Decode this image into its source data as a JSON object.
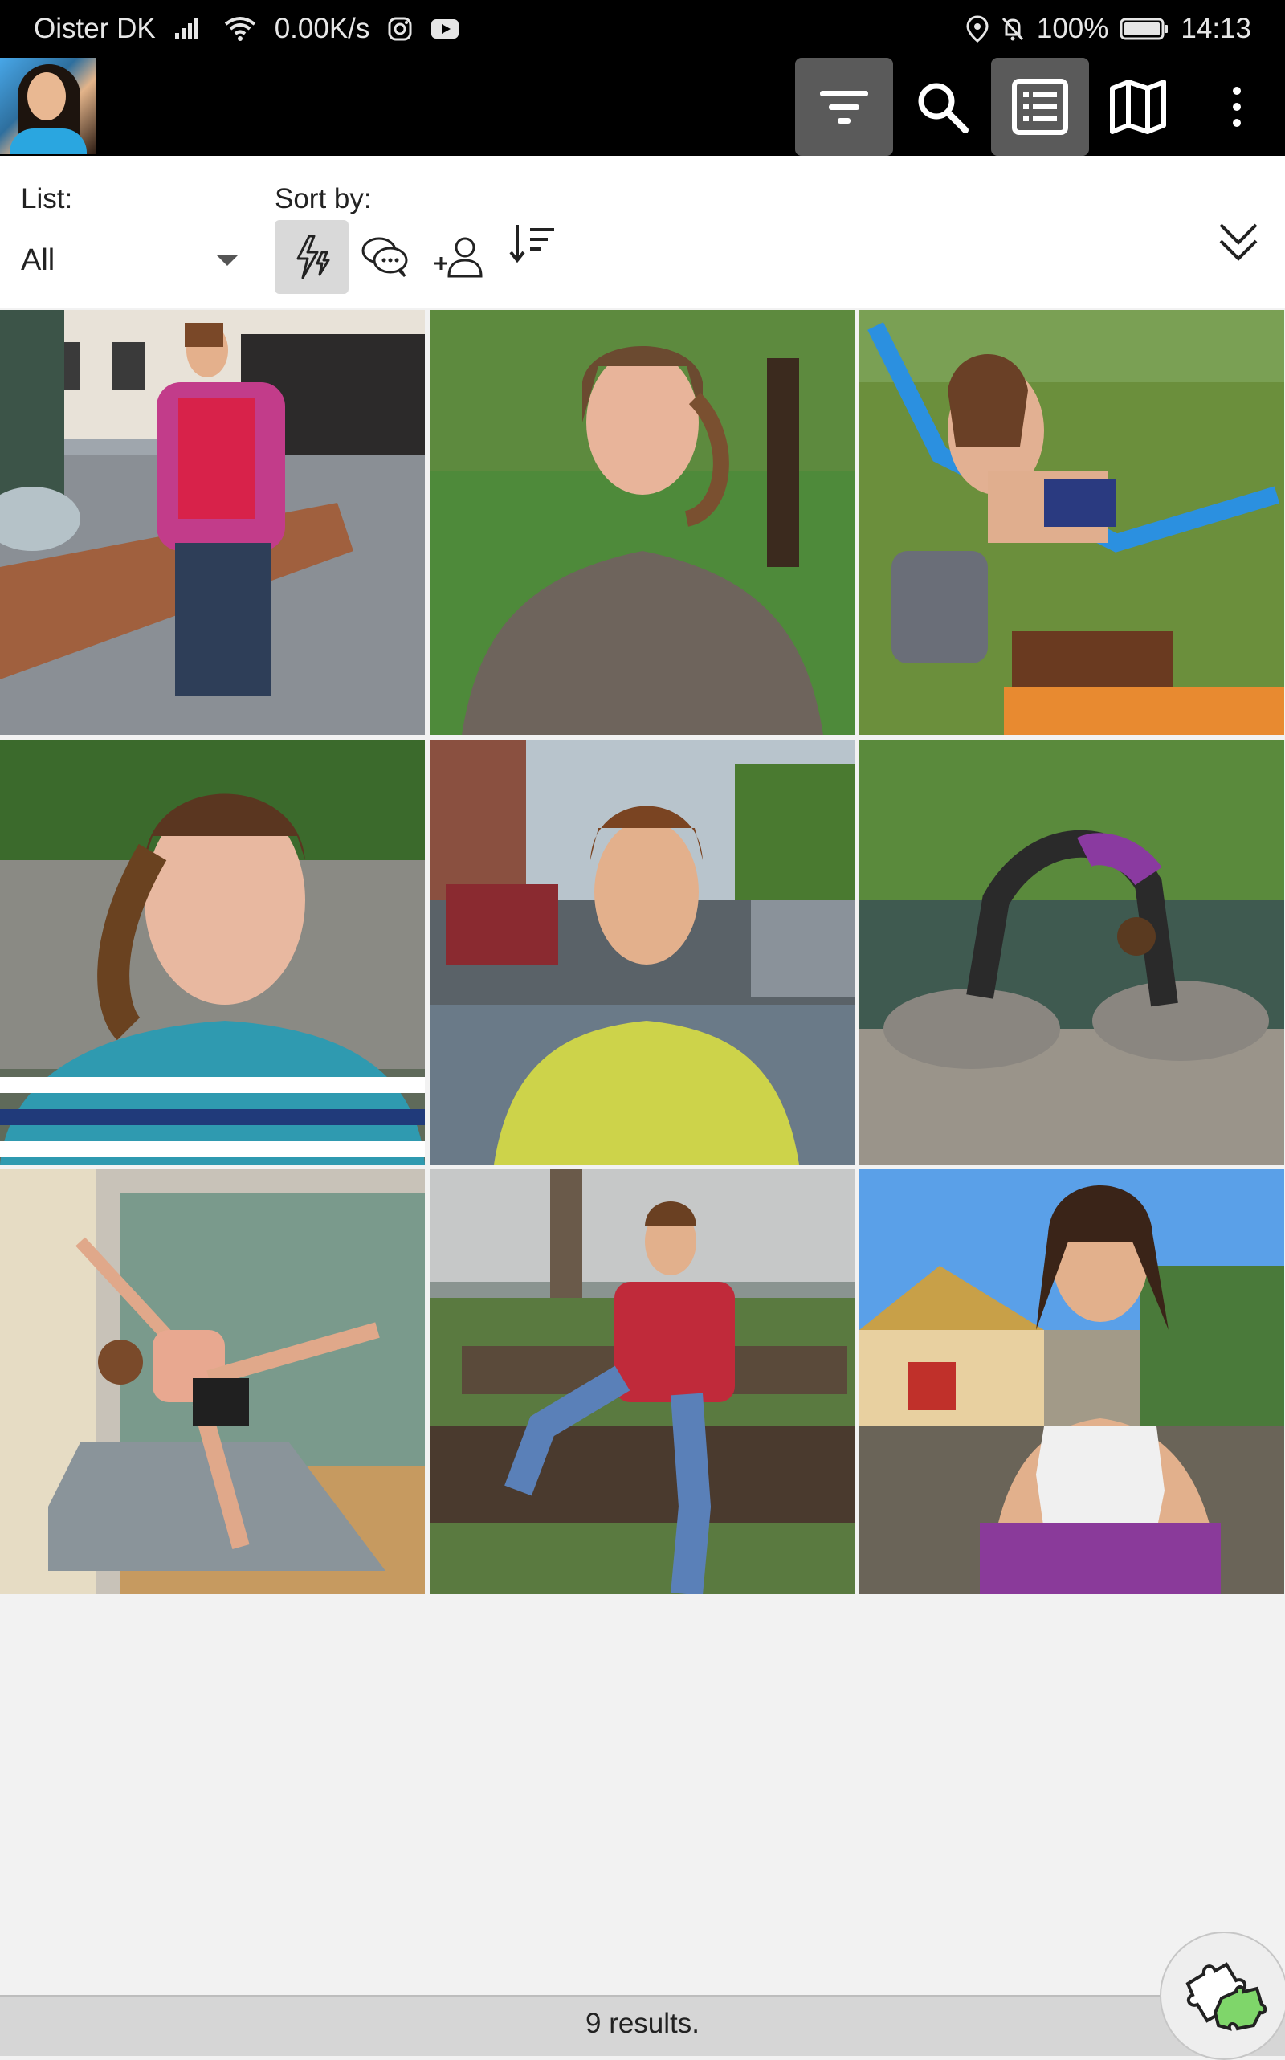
{
  "status_bar": {
    "carrier": "Oister DK",
    "net_speed": "0.00K/s",
    "battery": "100%",
    "time": "14:13"
  },
  "toolbar": {
    "icons": [
      "filter-icon",
      "search-icon",
      "list-view-icon",
      "map-icon",
      "more-vert-icon"
    ]
  },
  "filter": {
    "list_label": "List:",
    "list_value": "All",
    "sort_label": "Sort by:",
    "sort_options": [
      "activity-icon",
      "chat-icon",
      "person-add-icon",
      "sort-order-icon"
    ]
  },
  "grid": {
    "photos": [
      {
        "name": "photo-fountain-pink-jacket"
      },
      {
        "name": "photo-selfie-park-brown-tee"
      },
      {
        "name": "photo-chess-lounger"
      },
      {
        "name": "photo-selfie-striped-shirt"
      },
      {
        "name": "photo-selfie-yellow-shirt"
      },
      {
        "name": "photo-yoga-bridge-rocks"
      },
      {
        "name": "photo-gym-side-kick"
      },
      {
        "name": "photo-bench-plaid-shirt"
      },
      {
        "name": "photo-beach-tank-top"
      }
    ]
  },
  "footer": {
    "results_text": "9 results."
  },
  "colors": {
    "toolbar_bg": "#000000",
    "active_button_bg": "#5a5a5a",
    "results_bar_bg": "#d6d6d6",
    "body_bg": "#f2f2f2"
  }
}
